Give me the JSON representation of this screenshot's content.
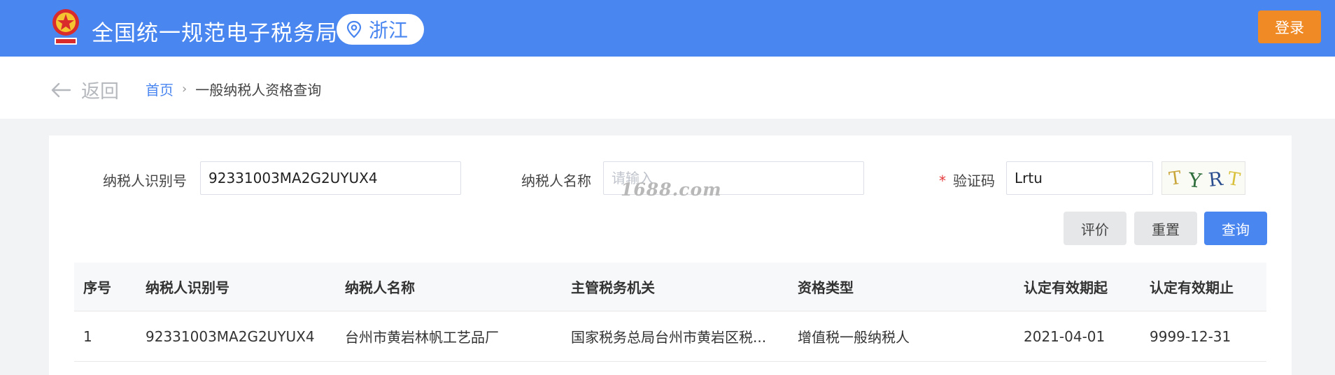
{
  "header": {
    "site_title": "全国统一规范电子税务局",
    "region": "浙江",
    "login_label": "登录",
    "icons": {
      "emblem": "tax-emblem-icon",
      "region_pin": "location-pin-icon"
    },
    "colors": {
      "bar": "#4a86f0",
      "login": "#f08a24"
    }
  },
  "nav": {
    "back_label": "返回",
    "back_icon": "arrow-left-icon",
    "breadcrumb": {
      "home": "首页",
      "separator": "›",
      "current": "一般纳税人资格查询"
    }
  },
  "form": {
    "taxpayer_id": {
      "label": "纳税人识别号",
      "value": "92331003MA2G2UYUX4"
    },
    "taxpayer_name": {
      "label": "纳税人名称",
      "placeholder": "请输入"
    },
    "captcha": {
      "label": "验证码",
      "required_mark": "*",
      "value": "Lrtu",
      "image_text": "TYRT"
    },
    "buttons": {
      "evaluate": "评价",
      "reset": "重置",
      "query": "查询"
    }
  },
  "table": {
    "columns": [
      "序号",
      "纳税人识别号",
      "纳税人名称",
      "主管税务机关",
      "资格类型",
      "认定有效期起",
      "认定有效期止"
    ],
    "rows": [
      [
        "1",
        "92331003MA2G2UYUX4",
        "台州市黄岩林帆工艺品厂",
        "国家税务总局台州市黄岩区税...",
        "增值税一般纳税人",
        "2021-04-01",
        "9999-12-31"
      ]
    ]
  },
  "watermark": "1688.com"
}
